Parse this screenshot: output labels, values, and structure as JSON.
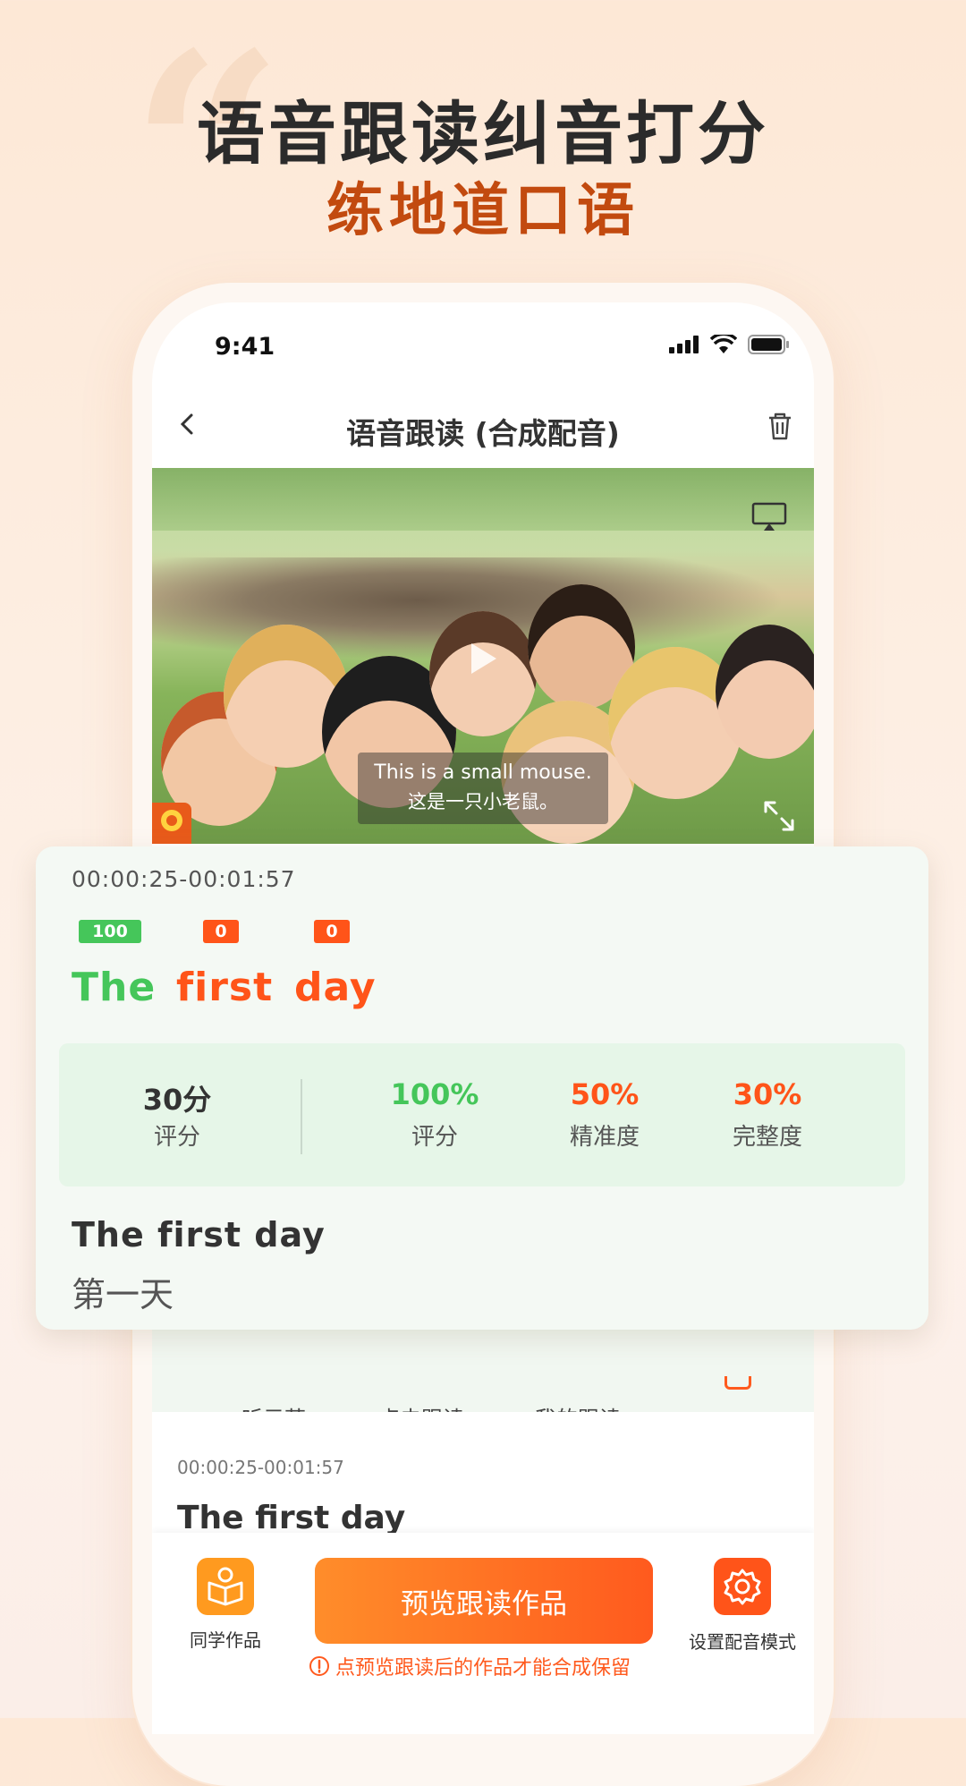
{
  "promo": {
    "headline": "语音跟读纠音打分",
    "subheadline": "练地道口语"
  },
  "status_bar": {
    "time": "9:41"
  },
  "nav": {
    "title": "语音跟读 (合成配音)"
  },
  "video": {
    "subtitle_en": "This is a small mouse.",
    "subtitle_zh": "这是一只小老鼠。"
  },
  "controls": {
    "listen_label": "听示范",
    "tap_read_label": "点击跟读",
    "my_read_label": "我的跟读"
  },
  "list_item": {
    "time": "00:00:25-00:01:57",
    "text_en": "The first day"
  },
  "score_card": {
    "time_range": "00:00:25-00:01:57",
    "words": [
      {
        "text": "The",
        "score": "100",
        "color": "#45c65a"
      },
      {
        "text": "first",
        "score": "0",
        "color": "#ff5419"
      },
      {
        "text": "day",
        "score": "0",
        "color": "#ff5419"
      }
    ],
    "total": {
      "value": "30分",
      "label": "评分"
    },
    "stats": [
      {
        "value": "100%",
        "label": "评分",
        "color": "#45c65a"
      },
      {
        "value": "50%",
        "label": "精准度",
        "color": "#ff5419"
      },
      {
        "value": "30%",
        "label": "完整度",
        "color": "#ff5419"
      }
    ],
    "sentence_en": "The first day",
    "sentence_zh": "第一天"
  },
  "bottom_bar": {
    "classmates_label": "同学作品",
    "preview_button": "预览跟读作品",
    "settings_label": "设置配音模式",
    "note": "点预览跟读后的作品才能合成保留"
  },
  "colors": {
    "accent_orange": "#ff5a1e",
    "icon_orange": "#ff9a1f",
    "score_green": "#45c65a",
    "score_red": "#ff5419"
  }
}
